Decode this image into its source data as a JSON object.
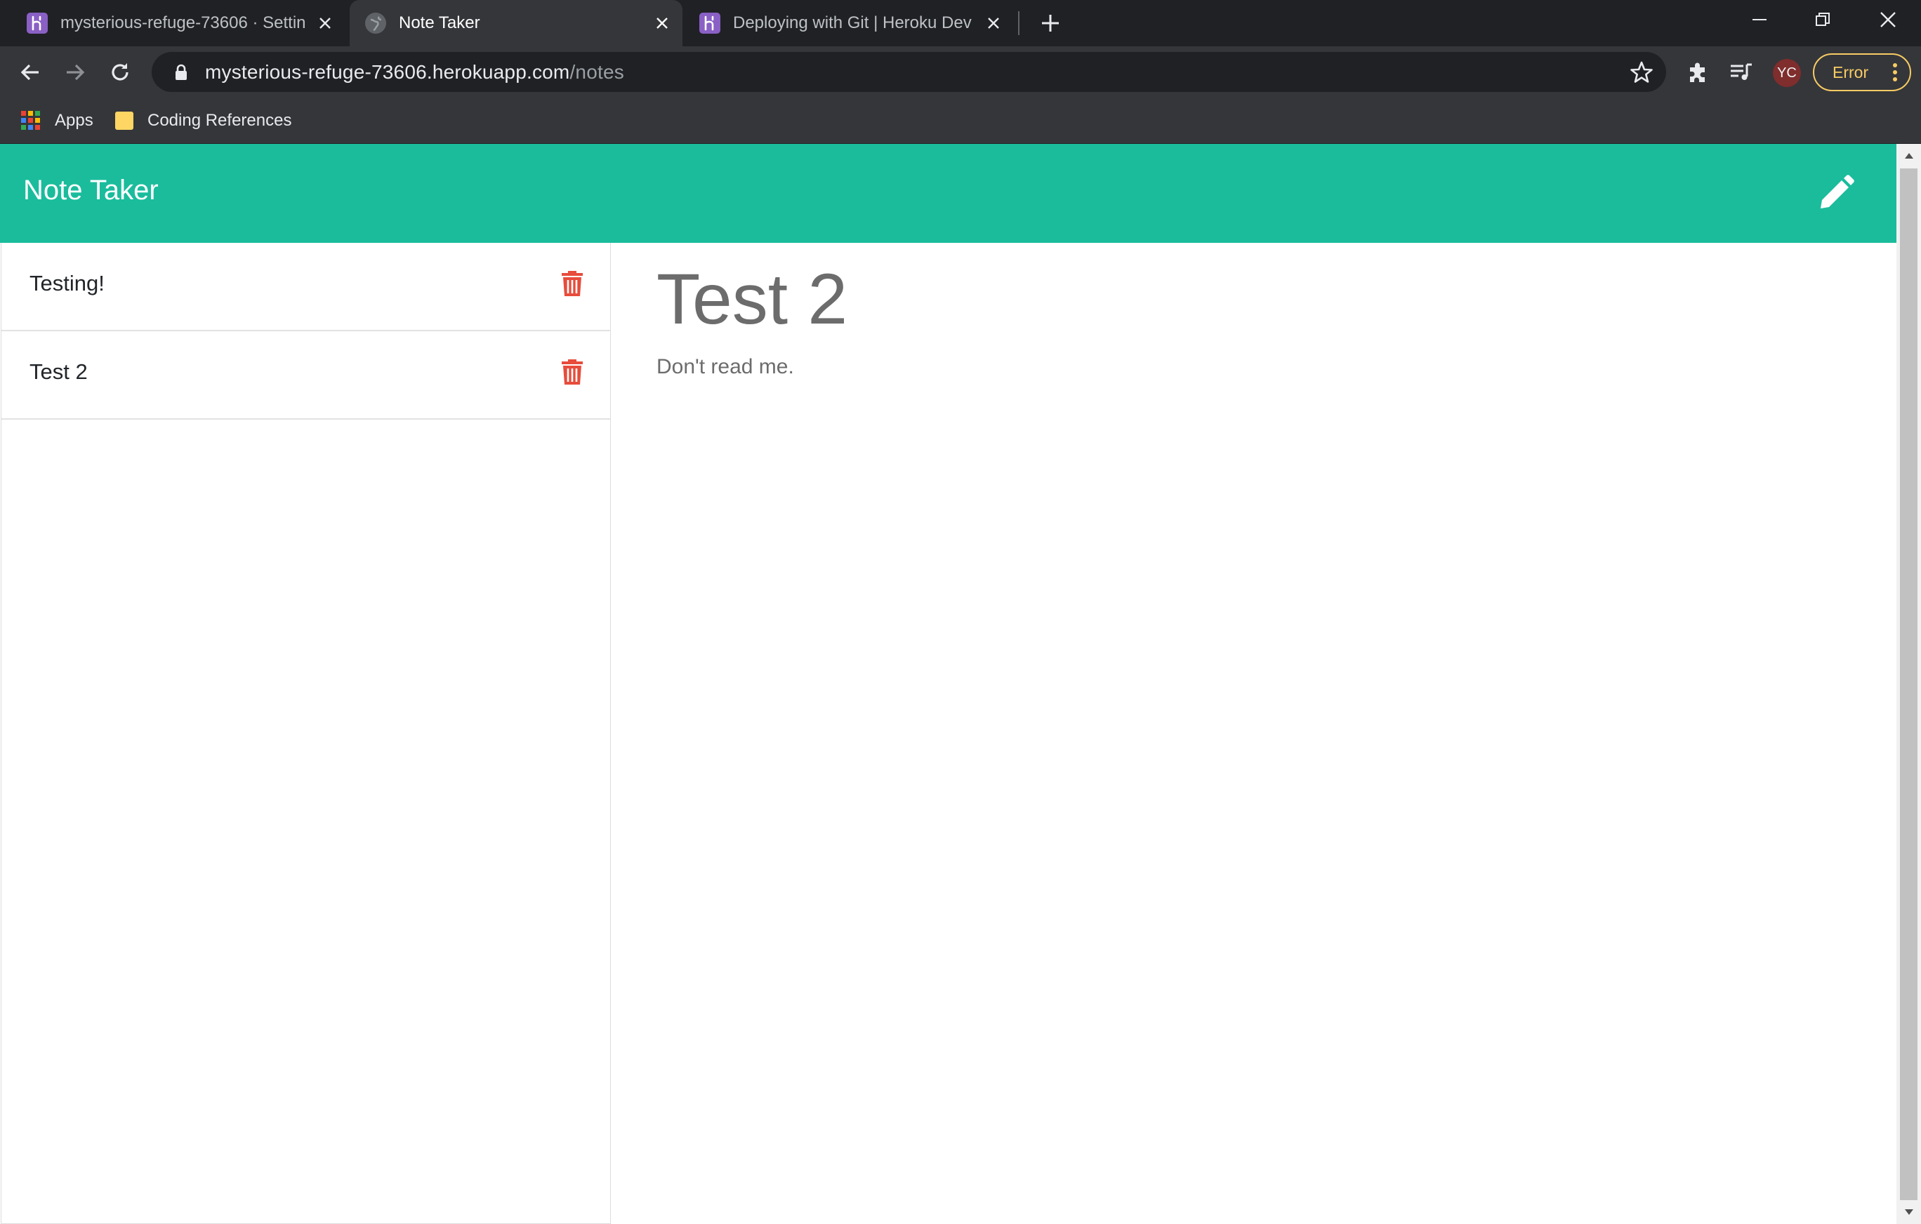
{
  "browser": {
    "tabs": [
      {
        "title": "mysterious-refuge-73606 · Settin",
        "favicon": "heroku-icon",
        "active": false
      },
      {
        "title": "Note Taker",
        "favicon": "globe-icon",
        "active": true
      },
      {
        "title": "Deploying with Git | Heroku Dev",
        "favicon": "heroku-icon",
        "active": false
      }
    ],
    "url_host": "mysterious-refuge-73606.herokuapp.com",
    "url_path": "/notes",
    "profile_initials": "YC",
    "error_label": "Error",
    "bookmarks": [
      {
        "label": "Apps",
        "icon": "apps-grid-icon"
      },
      {
        "label": "Coding References",
        "icon": "folder-icon"
      }
    ]
  },
  "app": {
    "brand": "Note Taker",
    "accent_color": "#1abc9c",
    "delete_color": "#e74c3c"
  },
  "notes": [
    {
      "title": "Testing!"
    },
    {
      "title": "Test 2"
    }
  ],
  "active_note": {
    "title": "Test 2",
    "text": "Don't read me."
  }
}
